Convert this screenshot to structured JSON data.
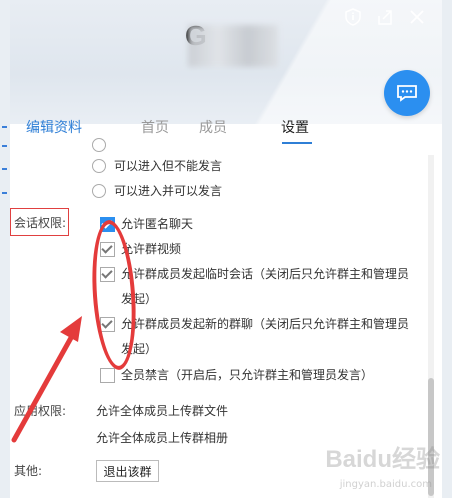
{
  "header": {
    "group_name": "G"
  },
  "tabs": {
    "edit": "编辑资料",
    "home": "首页",
    "members": "成员",
    "settings": "设置"
  },
  "join_options": [
    {
      "label": "可以进入但不能发言"
    },
    {
      "label": "可以进入并可以发言"
    }
  ],
  "session_perm": {
    "label": "会话权限:",
    "options": [
      {
        "label": "允许匿名聊天",
        "checked": true
      },
      {
        "label": "允许群视频",
        "checked": true
      },
      {
        "label": "允许群成员发起临时会话（关闭后只允许群主和管理员发起）",
        "checked": true
      },
      {
        "label": "允许群成员发起新的群聊（关闭后只允许群主和管理员发起）",
        "checked": true
      },
      {
        "label": "全员禁言（开启后，只允许群主和管理员发言）",
        "checked": false
      }
    ]
  },
  "app_perm": {
    "label": "应用权限:",
    "items": [
      "允许全体成员上传群文件",
      "允许全体成员上传群相册"
    ]
  },
  "other": {
    "label": "其他:",
    "exit_button": "退出该群"
  },
  "watermark": {
    "main": "Baidu经验",
    "sub": "jingyan.baidu.com"
  },
  "colors": {
    "accent": "#2b8ff0",
    "annotation": "#e43b3b"
  }
}
